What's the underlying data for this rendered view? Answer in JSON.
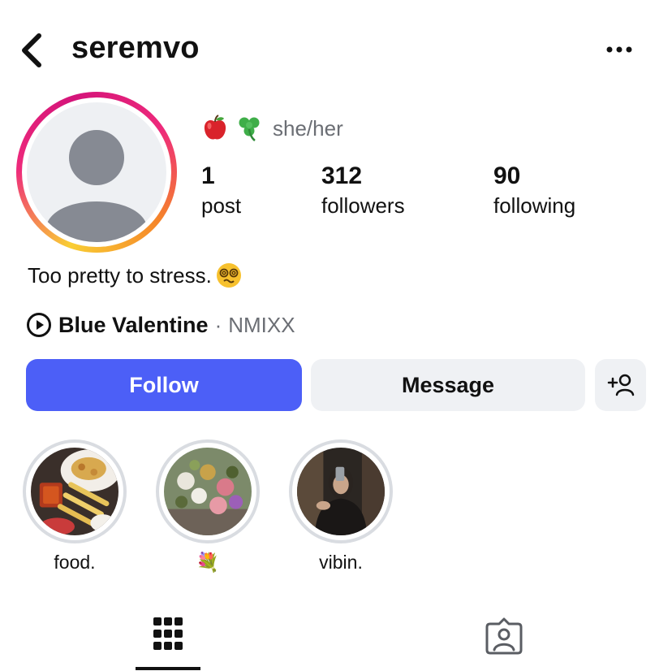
{
  "header": {
    "username": "seremvo",
    "back_icon": "chevron-left-icon",
    "more_icon": "more-horizontal-icon"
  },
  "profile": {
    "pronoun_emojis": [
      "🍎",
      "☘️"
    ],
    "pronouns": "she/her",
    "stats": [
      {
        "value": "1",
        "label": "post"
      },
      {
        "value": "312",
        "label": "followers"
      },
      {
        "value": "90",
        "label": "following"
      }
    ],
    "bio_text": "Too pretty to stress.",
    "bio_emoji": "😵‍💫",
    "music": {
      "song": "Blue Valentine",
      "separator": "·",
      "artist": "NMIXX",
      "icon": "play-circle-icon"
    }
  },
  "actions": {
    "follow_label": "Follow",
    "message_label": "Message",
    "add_user_icon": "add-user-icon"
  },
  "highlights": [
    {
      "label": "food."
    },
    {
      "label": "💐"
    },
    {
      "label": "vibin."
    }
  ],
  "tabs": [
    {
      "icon": "grid-icon",
      "active": true
    },
    {
      "icon": "tagged-icon",
      "active": false
    }
  ],
  "colors": {
    "accent": "#4c5ff7",
    "secondary_button": "#eff1f4",
    "muted_text": "#6b6e74"
  }
}
